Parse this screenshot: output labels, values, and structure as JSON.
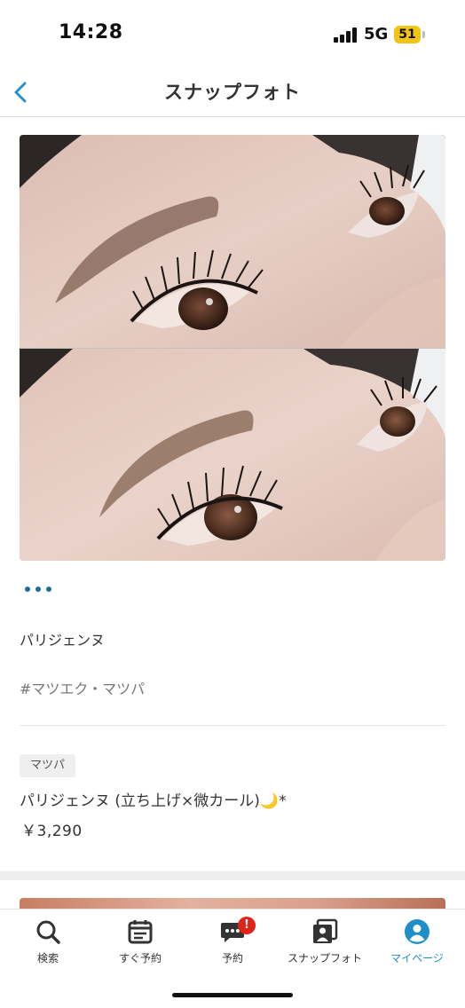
{
  "status_bar": {
    "time": "14:28",
    "network": "5G",
    "battery": "51"
  },
  "header": {
    "title": "スナップフォト",
    "back_icon": "chevron-left-icon"
  },
  "snap": {
    "salon_name": "パリジェンヌ",
    "hashtag": "#マツエク・マツパ",
    "category": "マツパ",
    "menu_name": "パリジェンヌ (立ち上げ×微カール)🌙*",
    "price": "￥3,290"
  },
  "tabs": [
    {
      "label": "検索",
      "icon": "search-icon"
    },
    {
      "label": "すぐ予約",
      "icon": "calendar-icon"
    },
    {
      "label": "予約",
      "icon": "chat-icon",
      "badge": "!"
    },
    {
      "label": "スナップフォト",
      "icon": "photo-icon"
    },
    {
      "label": "マイページ",
      "icon": "user-icon",
      "active": true
    }
  ],
  "colors": {
    "accent": "#1e8fc8",
    "badge": "#e0241b",
    "dots": "#1d6e8f"
  }
}
